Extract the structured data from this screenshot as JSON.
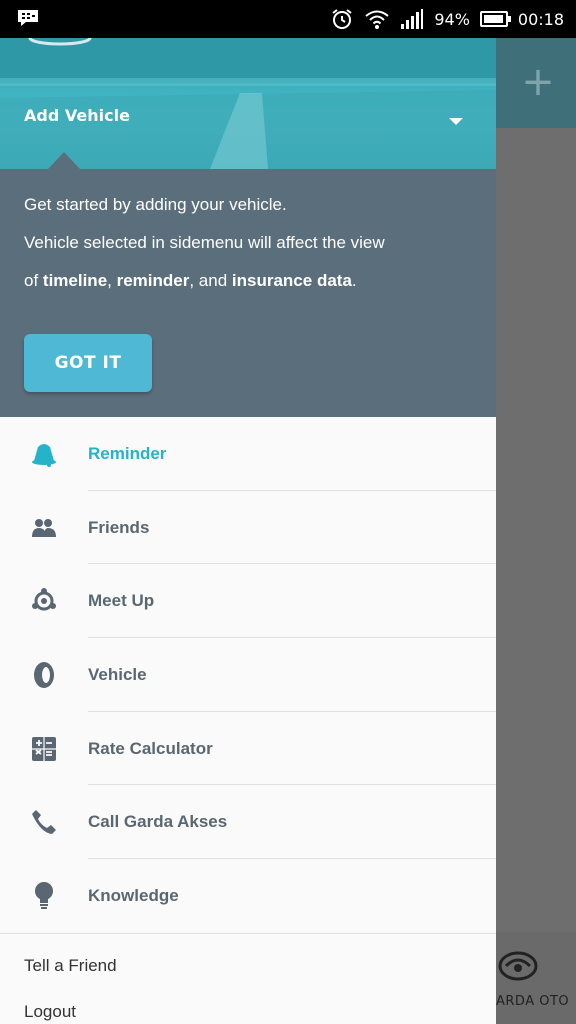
{
  "status_bar": {
    "battery_percent": "94%",
    "time": "00:18",
    "battery_level": 0.94
  },
  "drawer": {
    "header_title": "Add Vehicle",
    "tutorial": {
      "line1": "Get started by adding your vehicle.",
      "line2": "Vehicle selected in sidemenu will affect the view",
      "line3_prefix": "of ",
      "line3_timeline": "timeline",
      "line3_sep1": ", ",
      "line3_reminder": "reminder",
      "line3_sep2": ", and ",
      "line3_insurance": "insurance data",
      "line3_suffix": ".",
      "button_label": "GOT IT"
    },
    "menu_items": [
      {
        "label": "Reminder",
        "icon": "bell-icon",
        "active": true
      },
      {
        "label": "Friends",
        "icon": "people-icon",
        "active": false
      },
      {
        "label": "Meet Up",
        "icon": "meetup-icon",
        "active": false
      },
      {
        "label": "Vehicle",
        "icon": "tire-icon",
        "active": false
      },
      {
        "label": "Rate Calculator",
        "icon": "calculator-icon",
        "active": false
      },
      {
        "label": "Call Garda Akses",
        "icon": "phone-icon",
        "active": false
      },
      {
        "label": "Knowledge",
        "icon": "lightbulb-icon",
        "active": false
      }
    ],
    "secondary_items": [
      {
        "label": "Tell a Friend"
      },
      {
        "label": "Logout"
      }
    ]
  },
  "background_app": {
    "logo_text": "ARDA OTO"
  },
  "colors": {
    "accent": "#26b3c9",
    "tutorial_bg": "#5b6e7b",
    "button_bg": "#4fb8d5",
    "menu_text": "#5a6772"
  }
}
